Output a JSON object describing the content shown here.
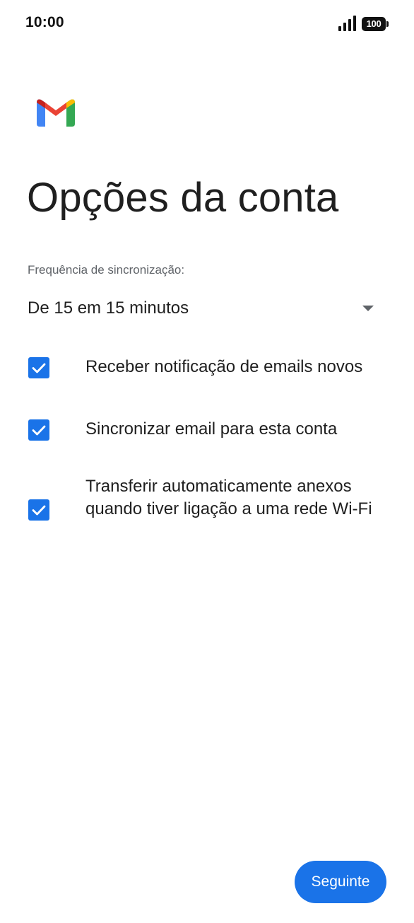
{
  "status_bar": {
    "time": "10:00",
    "battery": "100",
    "icons": [
      "signal-icon",
      "battery-icon"
    ]
  },
  "logo": {
    "icon": "gmail-logo-icon",
    "colors": {
      "blue": "#4285F4",
      "red": "#EA4335",
      "yellow": "#FBBC04",
      "green": "#34A853",
      "dark_red": "#C5221F"
    }
  },
  "page": {
    "title": "Opções da conta"
  },
  "sync": {
    "label": "Frequência de sincronização:",
    "selected": "De 15 em 15 minutos",
    "icon": "dropdown-arrow-icon"
  },
  "options": [
    {
      "label": "Receber notificação de emails novos",
      "checked": true
    },
    {
      "label": "Sincronizar email para esta conta",
      "checked": true
    },
    {
      "label": "Transferir automaticamente anexos quando tiver ligação a uma rede Wi-Fi",
      "checked": true
    }
  ],
  "actions": {
    "next_label": "Seguinte"
  },
  "colors": {
    "accent": "#1a73e8",
    "text": "#1f1f1f",
    "secondary_text": "#5f6368"
  }
}
